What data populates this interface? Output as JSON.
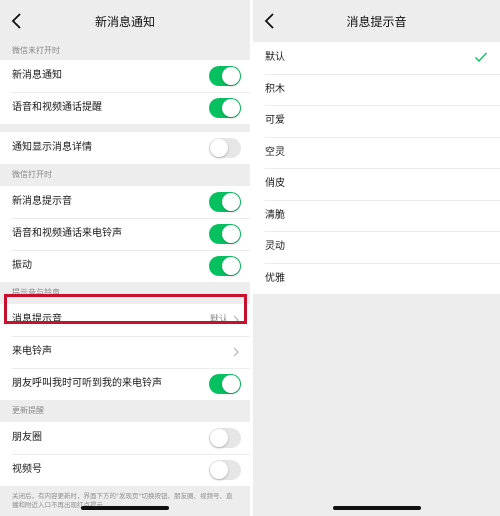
{
  "left": {
    "title": "新消息通知",
    "sections": [
      {
        "label": "微信未打开时"
      },
      {
        "label": "微信打开时"
      },
      {
        "label": "提示音与铃声"
      },
      {
        "label": "更新提醒"
      }
    ],
    "rows": {
      "new_message": {
        "label": "新消息通知",
        "toggle": true
      },
      "voice_video_reminder": {
        "label": "语音和视频通话提醒",
        "toggle": true
      },
      "show_details": {
        "label": "通知显示消息详情",
        "toggle": false
      },
      "message_sound": {
        "label": "新消息提示音",
        "toggle": true
      },
      "call_ringtone": {
        "label": "语音和视频通话来电铃声",
        "toggle": true
      },
      "vibrate": {
        "label": "振动",
        "toggle": true
      },
      "alert_sound": {
        "label": "消息提示音",
        "value": "默认"
      },
      "ringtone": {
        "label": "来电铃声"
      },
      "friends_hear_ringtone": {
        "label": "朋友呼叫我时可听到我的来电铃声",
        "toggle": true
      },
      "moments": {
        "label": "朋友圈",
        "toggle": false
      },
      "channels": {
        "label": "视频号",
        "toggle": false
      }
    },
    "footer_note": "关闭后，有内容更新时，界面下方的\"发现页\"切换按钮、朋友圈、视频号、直播和附近入口不再出现红点提示"
  },
  "right": {
    "title": "消息提示音",
    "options": [
      "默认",
      "积木",
      "可爱",
      "空灵",
      "俏皮",
      "清脆",
      "灵动",
      "优雅"
    ],
    "selected_index": 0
  },
  "colors": {
    "toggle_on": "#07c160",
    "highlight_border": "#c8102e",
    "check": "#07c160"
  }
}
